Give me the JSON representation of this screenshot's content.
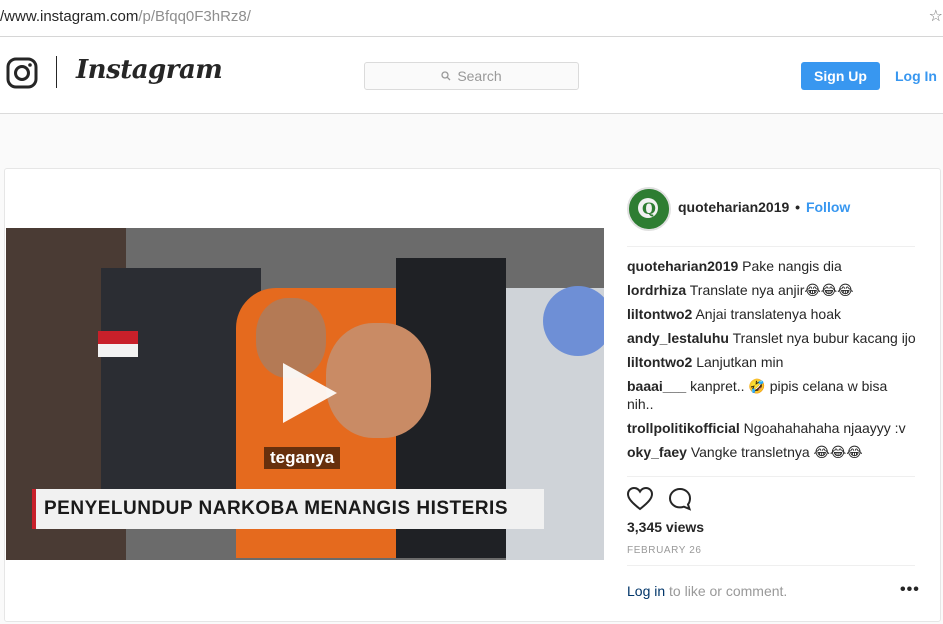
{
  "browser": {
    "url_prefix": "/www.instagram.com",
    "url_rest": "/p/Bfqq0F3hRz8/"
  },
  "header": {
    "wordmark": "Instagram",
    "search_placeholder": "Search",
    "signup_label": "Sign Up",
    "login_label": "Log In"
  },
  "post": {
    "owner": "quoteharian2019",
    "separator": "•",
    "follow_label": "Follow",
    "video": {
      "overlay_word": "teganya",
      "headline": "PENYELUNDUP NARKOBA MENANGIS HISTERIS"
    },
    "comments": [
      {
        "user": "quoteharian2019",
        "text": "Pake nangis dia"
      },
      {
        "user": "lordrhiza",
        "text": "Translate nya anjir😂😂😂"
      },
      {
        "user": "liltontwo2",
        "text": "Anjai translatenya hoak"
      },
      {
        "user": "andy_lestaluhu",
        "text": "Translet nya bubur kacang ijo"
      },
      {
        "user": "liltontwo2",
        "text": "Lanjutkan min"
      },
      {
        "user": "baaai___",
        "text": "kanpret.. 🤣 pipis celana w bisa nih.."
      },
      {
        "user": "trollpolitikofficial",
        "text": "Ngoahahahaha njaayyy :v"
      },
      {
        "user": "oky_faey",
        "text": "Vangke transletnya 😂😂😂"
      }
    ],
    "views": "3,345 views",
    "date": "FEBRUARY 26",
    "login_link": "Log in",
    "login_rest": " to like or comment.",
    "more": "•••"
  },
  "colors": {
    "accent": "#3897f0",
    "text": "#262626",
    "muted": "#999999",
    "border": "#dbdbdb"
  }
}
